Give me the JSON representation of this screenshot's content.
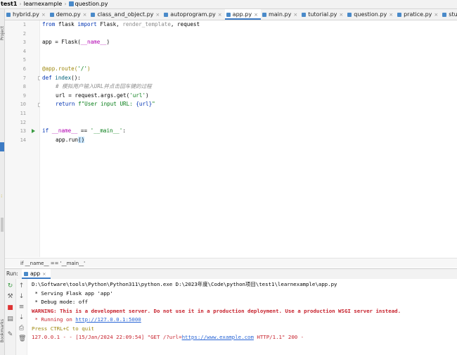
{
  "breadcrumb": {
    "project": "test1",
    "folder": "learnexample",
    "file": "question.py"
  },
  "tabs": [
    {
      "label": "hybrid.py",
      "active": false
    },
    {
      "label": "demo.py",
      "active": false
    },
    {
      "label": "class_and_object.py",
      "active": false
    },
    {
      "label": "autoprogram.py",
      "active": false
    },
    {
      "label": "app.py",
      "active": true
    },
    {
      "label": "main.py",
      "active": false
    },
    {
      "label": "tutorial.py",
      "active": false
    },
    {
      "label": "question.py",
      "active": false
    },
    {
      "label": "pratice.py",
      "active": false
    },
    {
      "label": "studen",
      "active": false
    }
  ],
  "left_strip": {
    "vertical_top": "Project",
    "vertical_bottom": "Bookmarks"
  },
  "editor": {
    "line_numbers": [
      "1",
      "2",
      "3",
      "4",
      "5",
      "6",
      "7",
      "8",
      "9",
      "10",
      "11",
      "12",
      "13",
      "14"
    ],
    "code": {
      "l1_kw1": "from",
      "l1_a": " flask ",
      "l1_kw2": "import",
      "l1_b": " Flask, ",
      "l1_c": "render_template",
      "l1_d": ", request",
      "l3_a": "app = Flask(",
      "l3_magic": "__name__",
      "l3_b": ")",
      "l6_dec": "@app.route(",
      "l6_str": "'/'",
      "l6_b": ")",
      "l7_kw": "def",
      "l7_fn": " index",
      "l7_b": "():",
      "l8_cmt": "# 模拟用户输入URL并点击回车键的过程",
      "l9_a": "url = request.args.get(",
      "l9_str": "'url'",
      "l9_b": ")",
      "l10_kw": "return",
      "l10_str": " f\"User input URL: ",
      "l10_brace": "{url}",
      "l10_end": "\"",
      "l13_kw": "if",
      "l13_magic": " __name__",
      "l13_a": " == ",
      "l13_str": "'__main__'",
      "l13_b": ":",
      "l14_a": "app.run",
      "l14_b": "()"
    }
  },
  "editor_breadcrumb": "if __name__ == '__main__'",
  "run_panel": {
    "label": "Run:",
    "tab": "app"
  },
  "console": {
    "line1": "D:\\Software\\tools\\Python\\Python311\\python.exe D:\\2023年度\\Code\\python项目\\test1\\learnexample\\app.py",
    "line2": " * Serving Flask app 'app'",
    "line3": " * Debug mode: off",
    "line4": "WARNING: This is a development server. Do not use it in a production deployment. Use a production WSGI server instead.",
    "line5_a": " * Running on ",
    "line5_link": "http://127.0.0.1:5000",
    "line6": "Press CTRL+C to quit",
    "line7_a": "127.0.0.1 - - [15/Jan/2024 22:09:54] \"GET /?url=",
    "line7_link": "https://www.example.com",
    "line7_b": " HTTP/1.1\" 200 -"
  },
  "colors": {
    "accent": "#3d7bc4",
    "run_green": "#3a9b42",
    "warning_red": "#c7222d",
    "link_blue": "#2a66d6"
  },
  "icons": {
    "run_tools": [
      "rerun-icon",
      "wrench-icon",
      "stop-icon",
      "layout-icon",
      "pin-icon"
    ],
    "console_tools": [
      "up-icon",
      "down-icon",
      "wrap-icon",
      "scroll-end-icon",
      "print-icon",
      "trash-icon"
    ]
  }
}
